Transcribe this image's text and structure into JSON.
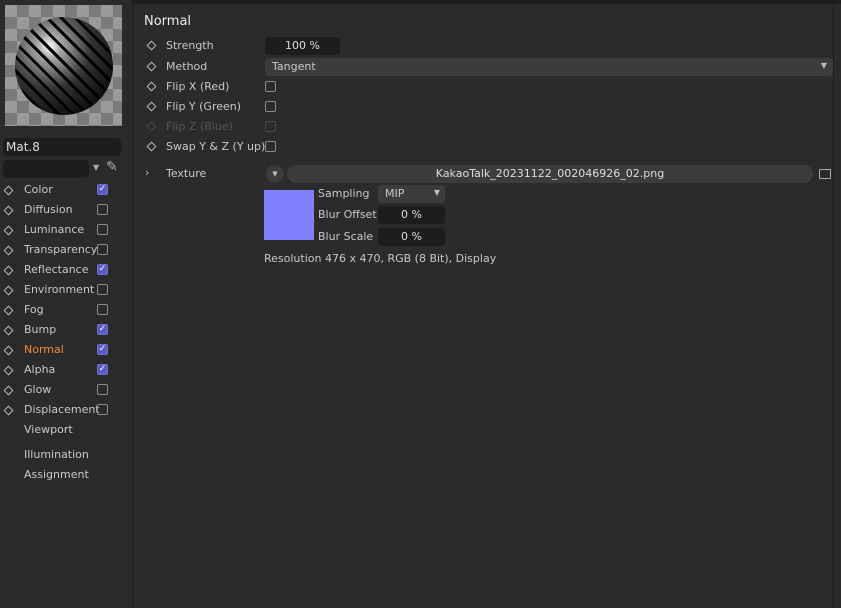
{
  "material": {
    "name": "Mat.8"
  },
  "channels": [
    {
      "label": "Color",
      "checked": true
    },
    {
      "label": "Diffusion",
      "checked": false
    },
    {
      "label": "Luminance",
      "checked": false
    },
    {
      "label": "Transparency",
      "checked": false
    },
    {
      "label": "Reflectance",
      "checked": true
    },
    {
      "label": "Environment",
      "checked": false
    },
    {
      "label": "Fog",
      "checked": false
    },
    {
      "label": "Bump",
      "checked": true
    },
    {
      "label": "Normal",
      "checked": true,
      "active": true
    },
    {
      "label": "Alpha",
      "checked": true
    },
    {
      "label": "Glow",
      "checked": false
    },
    {
      "label": "Displacement",
      "checked": false
    }
  ],
  "extra_items": [
    "Viewport",
    "Illumination",
    "Assignment"
  ],
  "panel": {
    "title": "Normal",
    "strength": {
      "label": "Strength",
      "value": "100 %"
    },
    "method": {
      "label": "Method",
      "value": "Tangent"
    },
    "flip_x": {
      "label": "Flip X (Red)",
      "checked": false
    },
    "flip_y": {
      "label": "Flip Y (Green)",
      "checked": false
    },
    "flip_z": {
      "label": "Flip Z (Blue)",
      "checked": false,
      "disabled": true
    },
    "swap": {
      "label": "Swap Y & Z (Y up)",
      "checked": false
    },
    "texture": {
      "label": "Texture",
      "filename": "KakaoTalk_20231122_002046926_02.png",
      "sampling": {
        "label": "Sampling",
        "value": "MIP"
      },
      "blur_offset": {
        "label": "Blur Offset",
        "value": "0 %"
      },
      "blur_scale": {
        "label": "Blur Scale",
        "value": "0 %"
      },
      "resolution": "Resolution 476 x 470, RGB (8 Bit), Display",
      "preview_color": "#8080ff"
    }
  },
  "colors": {
    "accent": "#5a5fc0",
    "active": "#f08a3c"
  }
}
